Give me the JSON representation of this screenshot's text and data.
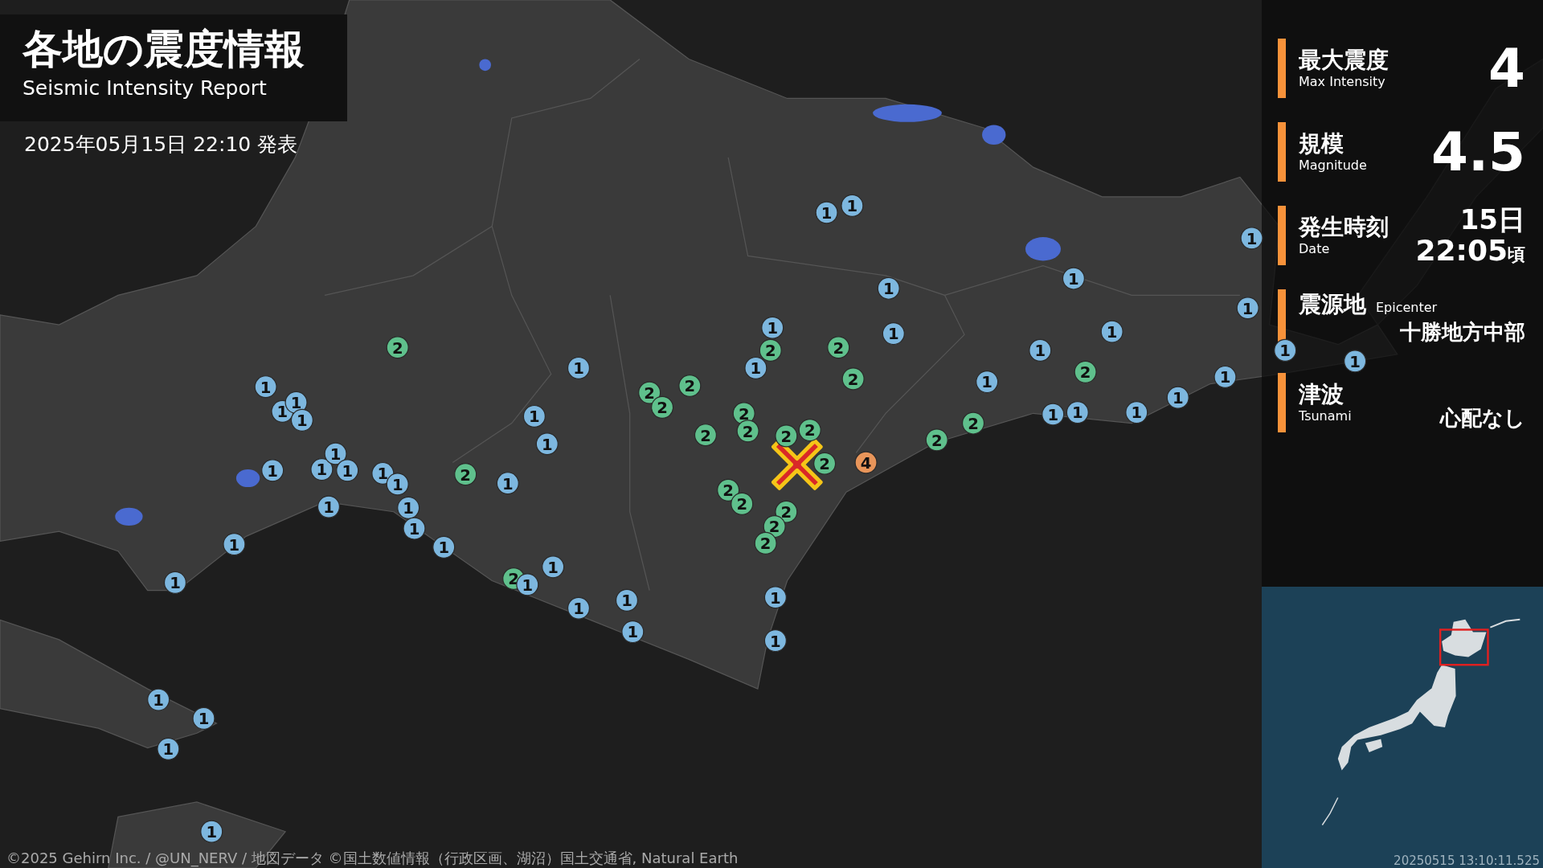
{
  "title": {
    "ja": "各地の震度情報",
    "en": "Seismic Intensity Report"
  },
  "issued": "2025年05月15日 22:10 発表",
  "summary": [
    {
      "kind": "large",
      "label_ja": "最大震度",
      "label_en": "Max Intensity",
      "value": "4"
    },
    {
      "kind": "large",
      "label_ja": "規模",
      "label_en": "Magnitude",
      "value": "4.5"
    },
    {
      "kind": "datetime",
      "label_ja": "発生時刻",
      "label_en": "Date",
      "day": "15日",
      "time": "22:05",
      "suffix": "頃"
    },
    {
      "kind": "inline",
      "label_ja": "震源地",
      "label_en": "Epicenter",
      "value": "十勝地方中部"
    },
    {
      "kind": "text",
      "label_ja": "津波",
      "label_en": "Tsunami",
      "value": "心配なし"
    }
  ],
  "markers": [
    {
      "label": "1",
      "color": "#7db7df"
    },
    {
      "label": "1",
      "color": "#7db7df"
    },
    {
      "label": "1",
      "color": "#7db7df"
    },
    {
      "label": "1",
      "color": "#7db7df"
    },
    {
      "label": "1",
      "color": "#7db7df"
    },
    {
      "label": "1",
      "color": "#7db7df"
    },
    {
      "label": "1",
      "color": "#7db7df"
    },
    {
      "label": "1",
      "color": "#7db7df"
    },
    {
      "label": "1",
      "color": "#7db7df"
    },
    {
      "label": "2",
      "color": "#5fc08c"
    },
    {
      "label": "2",
      "color": "#5fc08c"
    },
    {
      "label": "2",
      "color": "#5fc08c"
    },
    {
      "label": "1",
      "color": "#7db7df"
    },
    {
      "label": "1",
      "color": "#7db7df"
    },
    {
      "label": "1",
      "color": "#7db7df"
    },
    {
      "label": "1",
      "color": "#7db7df"
    },
    {
      "label": "2",
      "color": "#5fc08c"
    },
    {
      "label": "1",
      "color": "#7db7df"
    },
    {
      "label": "1",
      "color": "#7db7df"
    },
    {
      "label": "2",
      "color": "#5fc08c"
    },
    {
      "label": "2",
      "color": "#5fc08c"
    },
    {
      "label": "2",
      "color": "#5fc08c"
    },
    {
      "label": "1",
      "color": "#7db7df"
    },
    {
      "label": "1",
      "color": "#7db7df"
    },
    {
      "label": "1",
      "color": "#7db7df"
    },
    {
      "label": "1",
      "color": "#7db7df"
    },
    {
      "label": "1",
      "color": "#7db7df"
    },
    {
      "label": "1",
      "color": "#7db7df"
    },
    {
      "label": "2",
      "color": "#5fc08c"
    },
    {
      "label": "2",
      "color": "#5fc08c"
    },
    {
      "label": "1",
      "color": "#7db7df"
    },
    {
      "label": "1",
      "color": "#7db7df"
    },
    {
      "label": "1",
      "color": "#7db7df"
    },
    {
      "label": "1",
      "color": "#7db7df"
    },
    {
      "label": "1",
      "color": "#7db7df"
    },
    {
      "label": "2",
      "color": "#5fc08c"
    },
    {
      "label": "2",
      "color": "#5fc08c"
    },
    {
      "label": "2",
      "color": "#5fc08c"
    },
    {
      "label": "2",
      "color": "#5fc08c"
    },
    {
      "label": "2",
      "color": "#5fc08c"
    },
    {
      "label": "2",
      "color": "#5fc08c"
    },
    {
      "label": "1",
      "color": "#7db7df"
    },
    {
      "label": "1",
      "color": "#7db7df"
    },
    {
      "label": "1",
      "color": "#7db7df"
    },
    {
      "label": "1",
      "color": "#7db7df"
    },
    {
      "label": "1",
      "color": "#7db7df"
    },
    {
      "label": "1",
      "color": "#7db7df"
    },
    {
      "label": "2",
      "color": "#5fc08c"
    },
    {
      "label": "1",
      "color": "#7db7df"
    },
    {
      "label": "2",
      "color": "#5fc08c"
    },
    {
      "label": "4",
      "color": "#e8955a"
    },
    {
      "label": "2",
      "color": "#5fc08c"
    },
    {
      "label": "1",
      "color": "#7db7df"
    },
    {
      "label": "1",
      "color": "#7db7df"
    },
    {
      "label": "2",
      "color": "#5fc08c"
    },
    {
      "label": "2",
      "color": "#5fc08c"
    },
    {
      "label": "1",
      "color": "#7db7df"
    },
    {
      "label": "2",
      "color": "#5fc08c"
    },
    {
      "label": "1",
      "color": "#7db7df"
    },
    {
      "label": "1",
      "color": "#7db7df"
    },
    {
      "label": "2",
      "color": "#5fc08c"
    },
    {
      "label": "1",
      "color": "#7db7df"
    },
    {
      "label": "1",
      "color": "#7db7df"
    },
    {
      "label": "2",
      "color": "#5fc08c"
    },
    {
      "label": "1",
      "color": "#7db7df"
    },
    {
      "label": "1",
      "color": "#7db7df"
    },
    {
      "label": "1",
      "color": "#7db7df"
    },
    {
      "label": "1",
      "color": "#7db7df"
    },
    {
      "label": "1",
      "color": "#7db7df"
    },
    {
      "label": "1",
      "color": "#7db7df"
    },
    {
      "label": "1",
      "color": "#7db7df"
    },
    {
      "label": "1",
      "color": "#7db7df"
    },
    {
      "label": "1",
      "color": "#7db7df"
    },
    {
      "label": "1",
      "color": "#7db7df"
    }
  ],
  "credits": "©2025 Gehirn Inc. / @UN_NERV / 地図データ ©国土数値情報（行政区画、湖沼）国土交通省, Natural Earth",
  "minimap": {
    "timestamp": "20250515 13:10:11.525"
  }
}
